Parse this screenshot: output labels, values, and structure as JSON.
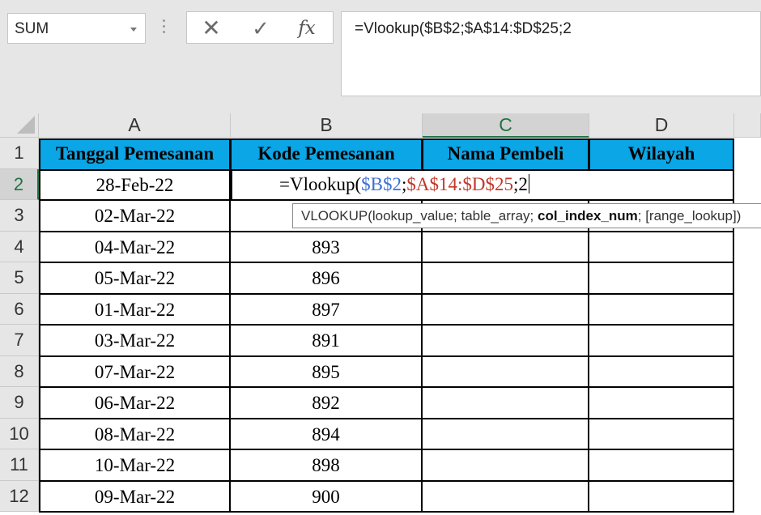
{
  "name_box": {
    "value": "SUM"
  },
  "formula_bar": {
    "cancel_icon": "✕",
    "enter_icon": "✓",
    "fx_icon": "fx",
    "formula": "=Vlookup($B$2;$A$14:$D$25;2"
  },
  "columns": [
    "A",
    "B",
    "C",
    "D"
  ],
  "selected_column": "C",
  "selected_row": "2",
  "table": {
    "headers": [
      "Tanggal Pemesanan",
      "Kode Pemesanan",
      "Nama Pembeli",
      "Wilayah"
    ],
    "rows": [
      {
        "row": "2",
        "date": "28-Feb-22",
        "code": ""
      },
      {
        "row": "3",
        "date": "02-Mar-22",
        "code": ""
      },
      {
        "row": "4",
        "date": "04-Mar-22",
        "code": "893"
      },
      {
        "row": "5",
        "date": "05-Mar-22",
        "code": "896"
      },
      {
        "row": "6",
        "date": "01-Mar-22",
        "code": "897"
      },
      {
        "row": "7",
        "date": "03-Mar-22",
        "code": "891"
      },
      {
        "row": "8",
        "date": "07-Mar-22",
        "code": "895"
      },
      {
        "row": "9",
        "date": "06-Mar-22",
        "code": "892"
      },
      {
        "row": "10",
        "date": "08-Mar-22",
        "code": "894"
      },
      {
        "row": "11",
        "date": "10-Mar-22",
        "code": "898"
      },
      {
        "row": "12",
        "date": "09-Mar-22",
        "code": "900"
      }
    ]
  },
  "edit": {
    "prefix": "=Vlookup(",
    "ref1": "$B$2",
    "sep1": ";",
    "ref2": "$A$14:$D$25",
    "sep2": ";2"
  },
  "tooltip": {
    "before": "VLOOKUP(lookup_value; table_array; ",
    "bold": "col_index_num",
    "after": "; [range_lookup])"
  },
  "colors": {
    "header_fill": "#0aa6e6",
    "ref1": "#3b6fd6",
    "ref2": "#c0392b",
    "selection": "#217346"
  }
}
